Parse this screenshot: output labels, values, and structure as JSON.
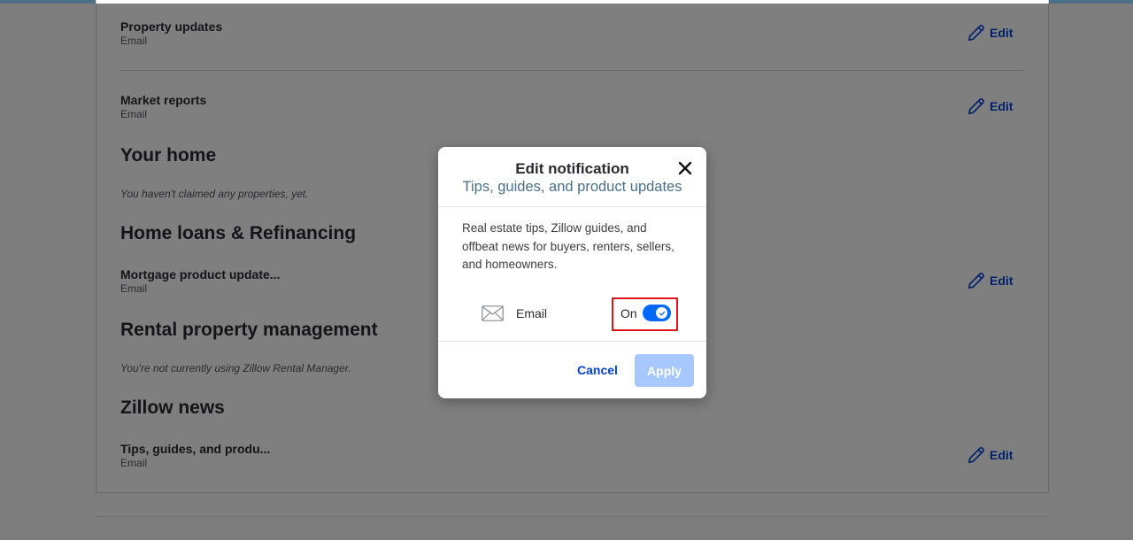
{
  "rows": {
    "property_updates": {
      "title": "Property updates",
      "channel": "Email",
      "edit": "Edit"
    },
    "market_reports": {
      "title": "Market reports",
      "channel": "Email",
      "edit": "Edit"
    },
    "mortgage": {
      "title": "Mortgage product update...",
      "channel": "Email",
      "edit": "Edit"
    },
    "tips": {
      "title": "Tips, guides, and produ...",
      "channel": "Email",
      "edit": "Edit"
    }
  },
  "sections": {
    "your_home": {
      "heading": "Your home",
      "note": "You haven't claimed any properties, yet."
    },
    "home_loans": {
      "heading": "Home loans & Refinancing"
    },
    "rental": {
      "heading": "Rental property management",
      "note": "You're not currently using Zillow Rental Manager."
    },
    "zillow_news": {
      "heading": "Zillow news"
    }
  },
  "modal": {
    "title": "Edit notification",
    "subtitle": "Tips, guides, and product updates",
    "description": "Real estate tips, Zillow guides, and offbeat news for buyers, renters, sellers, and homeowners.",
    "channel_label": "Email",
    "toggle_label": "On",
    "toggle_on": true,
    "cancel_label": "Cancel",
    "apply_label": "Apply",
    "icons": {
      "close": "close-icon",
      "mail": "mail-icon",
      "check": "check-icon"
    }
  },
  "colors": {
    "accent": "#006aff",
    "link": "#0041d9",
    "apply_disabled": "#a7c8ff",
    "subtitle": "#4b6f87",
    "highlight": "#e0141e"
  }
}
